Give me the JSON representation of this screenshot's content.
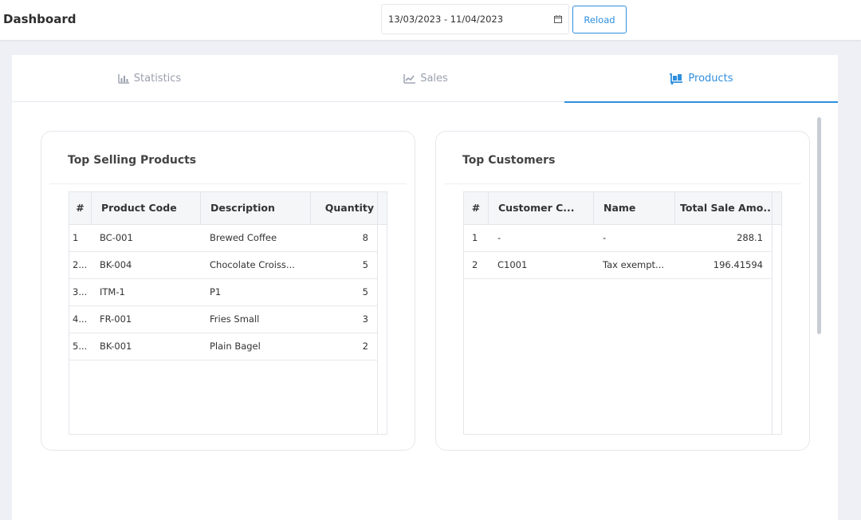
{
  "header": {
    "title": "Dashboard",
    "date_range": "13/03/2023 - 11/04/2023",
    "reload_label": "Reload"
  },
  "tabs": [
    {
      "label": "Statistics",
      "icon": "bar-chart-icon",
      "active": false
    },
    {
      "label": "Sales",
      "icon": "line-chart-icon",
      "active": false
    },
    {
      "label": "Products",
      "icon": "dolly-icon",
      "active": true
    }
  ],
  "colors": {
    "accent": "#2f8fdd",
    "muted": "#9aa0ad"
  },
  "top_products": {
    "title": "Top Selling Products",
    "columns": [
      "#",
      "Product Code",
      "Description",
      "Quantity"
    ],
    "rows": [
      {
        "num": "1",
        "code": "BC-001",
        "desc": "Brewed Coffee",
        "qty": "8"
      },
      {
        "num": "2...",
        "code": "BK-004",
        "desc": "Chocolate Croiss...",
        "qty": "5"
      },
      {
        "num": "3...",
        "code": "ITM-1",
        "desc": "P1",
        "qty": "5"
      },
      {
        "num": "4...",
        "code": "FR-001",
        "desc": "Fries Small",
        "qty": "3"
      },
      {
        "num": "5...",
        "code": "BK-001",
        "desc": "Plain Bagel",
        "qty": "2"
      }
    ]
  },
  "top_customers": {
    "title": "Top Customers",
    "columns": [
      "#",
      "Customer C...",
      "Name",
      "Total Sale Amo..."
    ],
    "rows": [
      {
        "num": "1",
        "code": "-",
        "name": "-",
        "total": "288.1"
      },
      {
        "num": "2",
        "code": "C1001",
        "name": "Tax exempt...",
        "total": "196.41594"
      }
    ]
  }
}
